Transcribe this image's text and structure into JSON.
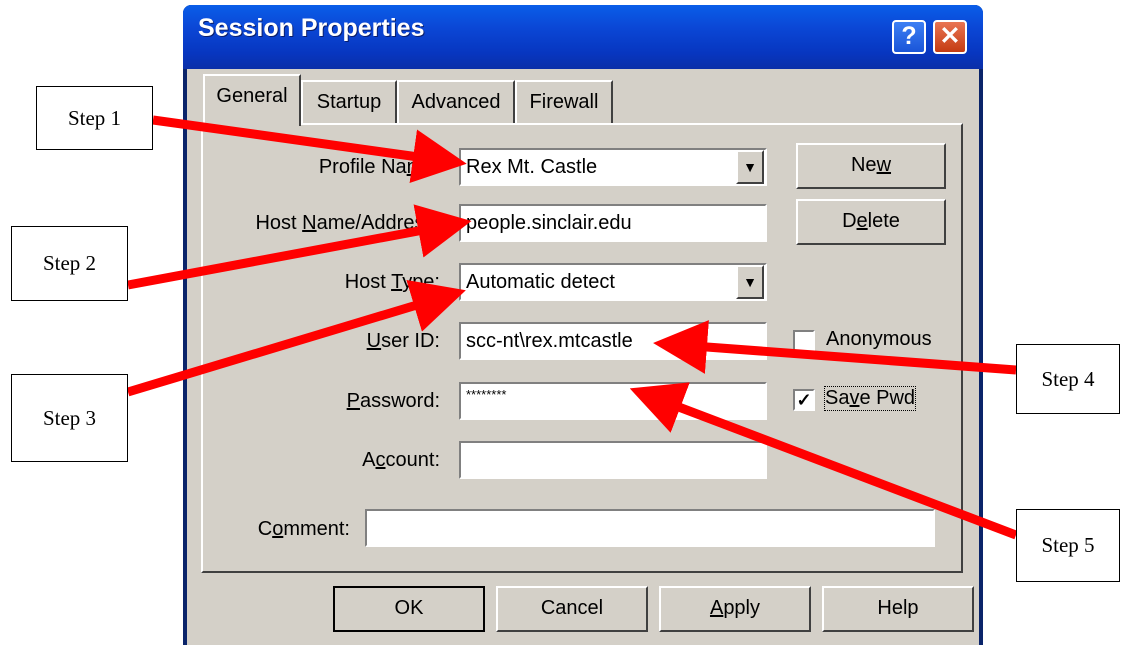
{
  "window": {
    "title": "Session Properties",
    "help_label": "?",
    "close_label": "✕"
  },
  "tabs": [
    "General",
    "Startup",
    "Advanced",
    "Firewall"
  ],
  "fields": {
    "profile_name": {
      "label": "Profile Name:",
      "value": "Rex Mt. Castle"
    },
    "host_name": {
      "label": "Host Name/Address:",
      "value": "people.sinclair.edu"
    },
    "host_type": {
      "label": "Host Type:",
      "value": "Automatic detect"
    },
    "user_id": {
      "label": "User ID:",
      "value": "scc-nt\\rex.mtcastle"
    },
    "password": {
      "label": "Password:",
      "value": "********"
    },
    "account": {
      "label": "Account:",
      "value": ""
    },
    "comment": {
      "label": "Comment:",
      "value": ""
    }
  },
  "side_buttons": {
    "new": "New",
    "delete": "Delete"
  },
  "checkboxes": {
    "anonymous": {
      "label": "Anonymous",
      "checked": false
    },
    "save_pwd": {
      "label": "Save Pwd",
      "checked": true
    }
  },
  "bottom_buttons": {
    "ok": "OK",
    "cancel": "Cancel",
    "apply": "Apply",
    "help": "Help"
  },
  "steps": [
    "Step 1",
    "Step 2",
    "Step 3",
    "Step 4",
    "Step 5"
  ],
  "annotation_color": "#ff0000"
}
